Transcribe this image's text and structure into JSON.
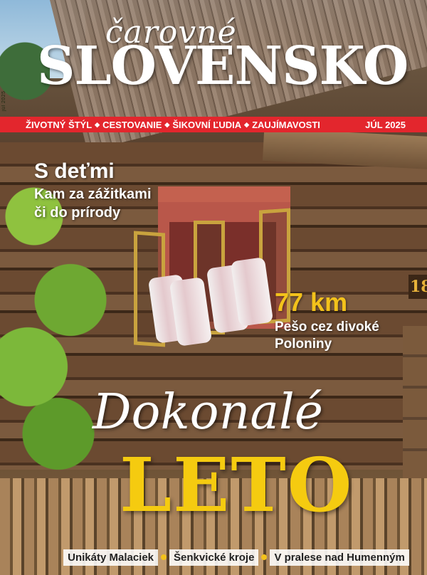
{
  "masthead": {
    "subtitle": "čarovné",
    "title": "SLOVENSKO",
    "issue_spine": "júl 2025"
  },
  "categories": [
    "ŽIVOTNÝ ŠTÝL",
    "CESTOVANIE",
    "ŠIKOVNÍ ĽUDIA",
    "ZAUJÍMAVOSTI"
  ],
  "issue_date": "JÚL 2025",
  "house_number": "18",
  "story_kids": {
    "title": "S deťmi",
    "line1": "Kam za zážitkami",
    "line2": "či do prírody"
  },
  "story_hike": {
    "title": "77 km",
    "line1": "Pešo cez divoké",
    "line2": "Poloniny"
  },
  "headline": {
    "script": "Dokonalé",
    "big": "LETO"
  },
  "footer": [
    "Unikáty Malaciek",
    "Šenkvické kroje",
    "V pralese nad Humenným"
  ],
  "colors": {
    "strip_red": "#e3262d",
    "accent_yellow": "#f3c21b"
  }
}
